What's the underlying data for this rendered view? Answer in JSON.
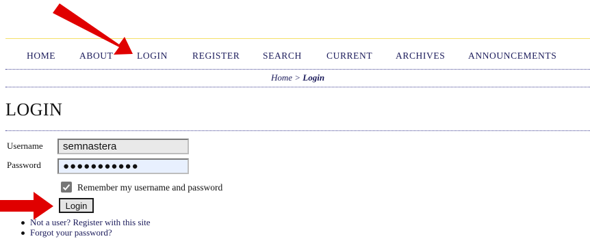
{
  "nav": {
    "items": [
      {
        "label": "HOME"
      },
      {
        "label": "ABOUT"
      },
      {
        "label": "LOGIN"
      },
      {
        "label": "REGISTER"
      },
      {
        "label": "SEARCH"
      },
      {
        "label": "CURRENT"
      },
      {
        "label": "ARCHIVES"
      },
      {
        "label": "ANNOUNCEMENTS"
      }
    ]
  },
  "breadcrumb": {
    "home": "Home",
    "separator": ">",
    "current": "Login"
  },
  "page": {
    "title": "LOGIN"
  },
  "form": {
    "username_label": "Username",
    "username_value": "semnastera",
    "password_label": "Password",
    "password_value": "●●●●●●●●●●●",
    "remember_label": "Remember my username and password",
    "remember_checked": true,
    "submit_label": "Login"
  },
  "links": [
    {
      "label": "Not a user? Register with this site"
    },
    {
      "label": "Forgot your password?"
    }
  ],
  "colors": {
    "nav_text": "#1a1a5a",
    "top_rule": "#f5e066",
    "arrow": "#e00000",
    "autofill": "#e8f0fe"
  },
  "icons": {
    "annotation_arrows": "red-arrow-icon",
    "checkbox": "checkmark-icon"
  }
}
